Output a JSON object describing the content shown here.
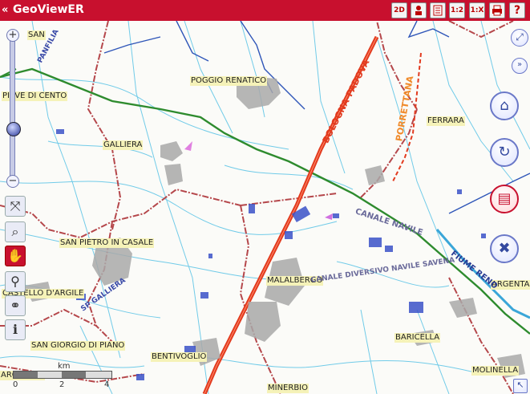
{
  "app": {
    "title": "GeoViewER"
  },
  "toolbar": {
    "buttons": [
      {
        "id": "2d",
        "label": "2D",
        "icon": "2d-view-icon"
      },
      {
        "id": "person",
        "label": "",
        "icon": "person-icon"
      },
      {
        "id": "print-map",
        "label": "",
        "icon": "document-icon"
      },
      {
        "id": "ratio",
        "label": "1:2",
        "icon": "scale-icon"
      },
      {
        "id": "scale",
        "label": "1:X",
        "icon": "scale-x-icon"
      },
      {
        "id": "print",
        "label": "",
        "icon": "printer-icon"
      },
      {
        "id": "help",
        "label": "?",
        "icon": "help-icon"
      }
    ]
  },
  "map": {
    "places": [
      {
        "name": "SAN...",
        "text": "SAN"
      },
      {
        "name": "poggio",
        "text": "POGGIO RENATICO"
      },
      {
        "name": "pieve",
        "text": "PIEVE DI CENTO"
      },
      {
        "name": "galliera",
        "text": "GALLIERA"
      },
      {
        "name": "ferrara",
        "text": "FERRARA"
      },
      {
        "name": "spietro",
        "text": "SAN PIETRO IN CASALE"
      },
      {
        "name": "castello",
        "text": "CASTELLO D'ARGILE"
      },
      {
        "name": "sgiorgio",
        "text": "SAN GIORGIO DI PIANO"
      },
      {
        "name": "bentivoglio",
        "text": "BENTIVOGLIO"
      },
      {
        "name": "malalbergo",
        "text": "MALALBERGO"
      },
      {
        "name": "baricella",
        "text": "BARICELLA"
      },
      {
        "name": "molinella",
        "text": "MOLINELLA"
      },
      {
        "name": "minerbio",
        "text": "MINERBIO"
      },
      {
        "name": "argelato",
        "text": "ARGELATO"
      },
      {
        "name": "argenta",
        "text": "ARGENTA"
      }
    ],
    "roads": [
      {
        "text": "BOLOGNA-PADOVA"
      },
      {
        "text": "PORRETTANA"
      }
    ],
    "waters": [
      {
        "text": "CANALE NAVILE"
      },
      {
        "text": "CANALE DIVERSIVO NAVILE SAVENA"
      },
      {
        "text": "FIUME RENO"
      },
      {
        "text": "PANFILIA"
      },
      {
        "text": "SP GALLIERA"
      }
    ]
  },
  "scale": {
    "unit": "km",
    "ticks": [
      "0",
      "2",
      "4"
    ]
  },
  "colors": {
    "topbar": "#c8102e",
    "road": "#e23b1f",
    "rail": "#2e8b2e",
    "water": "#3aa6d8",
    "boundary": "#b5474b"
  }
}
